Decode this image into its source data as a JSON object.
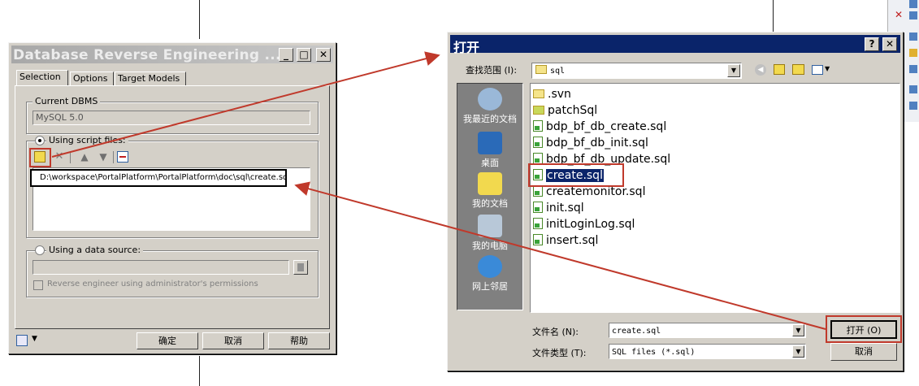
{
  "dre": {
    "title": "Database Reverse Engineering ...",
    "tabs": [
      "Selection",
      "Options",
      "Target Models"
    ],
    "current_dbms_label": "Current DBMS",
    "current_dbms_value": "MySQL 5.0",
    "using_script_files_label": "Using script files:",
    "script_path": "D:\\workspace\\PortalPlatform\\PortalPlatform\\doc\\sql\\create.sql",
    "using_data_source_label": "Using a data source:",
    "admin_permissions_label": "Reverse engineer using administrator's permissions",
    "ok_label": "确定",
    "cancel_label": "取消",
    "help_label": "帮助"
  },
  "open": {
    "title": "打开",
    "lookin_label": "查找范围 (I):",
    "lookin_value": "sql",
    "places": [
      "我最近的文档",
      "桌面",
      "我的文档",
      "我的电脑",
      "网上邻居"
    ],
    "files": [
      ".svn",
      "patchSql",
      "bdp_bf_db_create.sql",
      "bdp_bf_db_init.sql",
      "bdp_bf_db_update.sql",
      "create.sql",
      "createmonitor.sql",
      "init.sql",
      "initLoginLog.sql",
      "insert.sql"
    ],
    "filename_label": "文件名 (N):",
    "filename_value": "create.sql",
    "filetype_label": "文件类型 (T):",
    "filetype_value": "SQL files (*.sql)",
    "open_label": "打开 (O)",
    "cancel_label": "取消"
  },
  "colors": {
    "title_gradient_start": "#a8a8a8",
    "title_gradient_end": "#c8c8c8",
    "open_title": "#0a246a",
    "annotation": "#c0392b"
  }
}
